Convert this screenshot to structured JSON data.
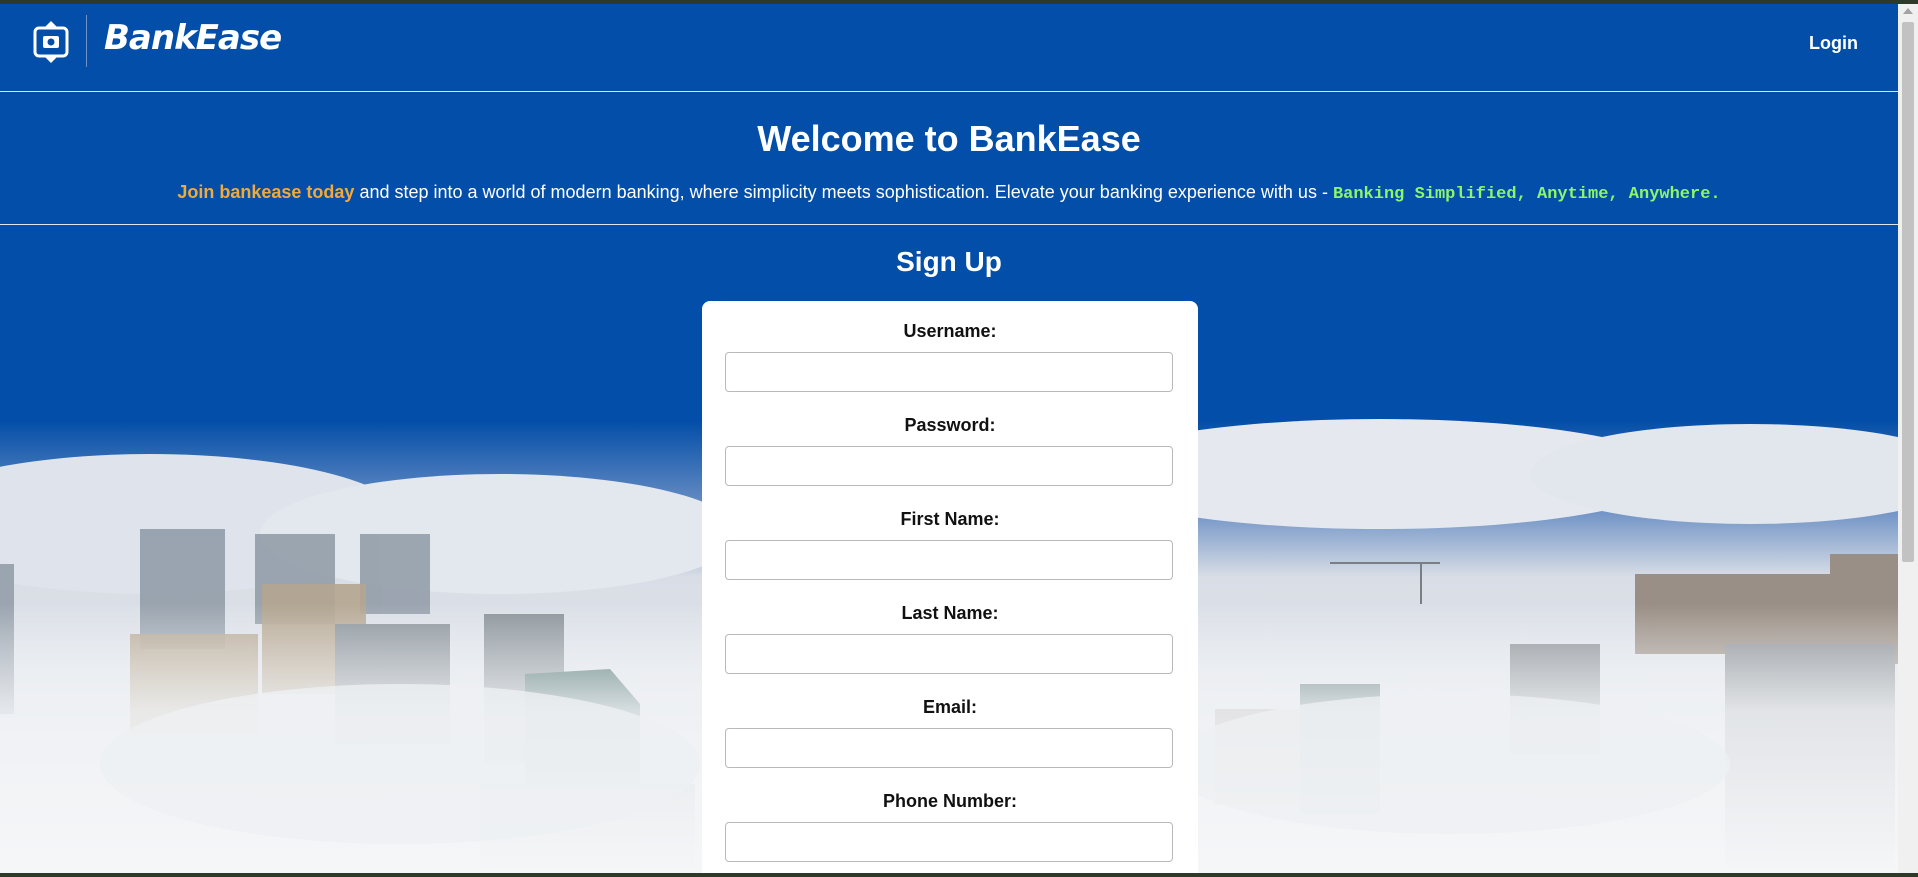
{
  "header": {
    "brand": "BankEase",
    "login_label": "Login"
  },
  "hero": {
    "title": "Welcome to BankEase",
    "join_text": "Join bankease today",
    "body_text": " and step into a world of modern banking, where simplicity meets sophistication. Elevate your banking experience with us - ",
    "motto": "Banking Simplified, Anytime, Anywhere",
    "period": "."
  },
  "signup": {
    "title": "Sign Up",
    "fields": [
      {
        "label": "Username:",
        "value": ""
      },
      {
        "label": "Password:",
        "value": ""
      },
      {
        "label": "First Name:",
        "value": ""
      },
      {
        "label": "Last Name:",
        "value": ""
      },
      {
        "label": "Email:",
        "value": ""
      },
      {
        "label": "Phone Number:",
        "value": ""
      }
    ]
  },
  "colors": {
    "primary_blue": "#034ea8",
    "join_orange": "#f2a93b",
    "motto_green": "#8cf56a"
  }
}
